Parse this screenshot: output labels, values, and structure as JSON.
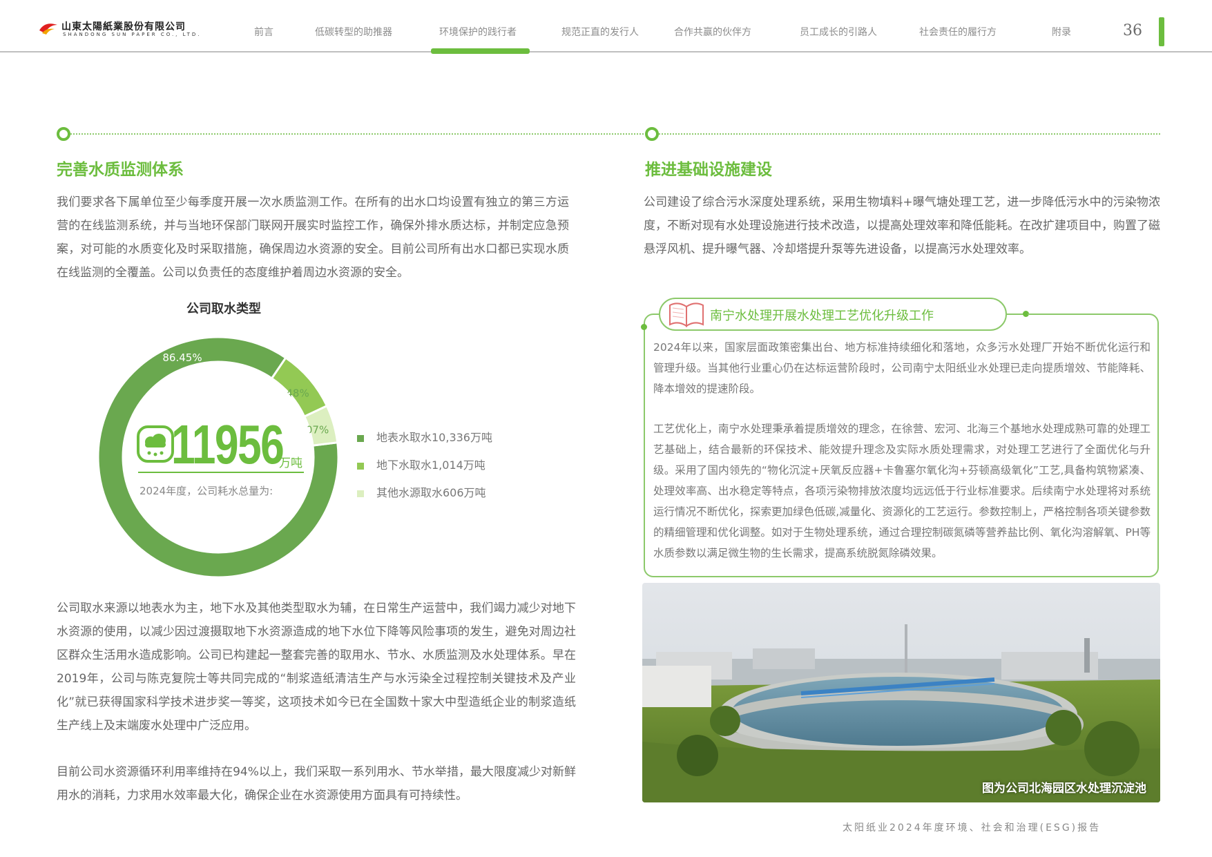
{
  "header": {
    "company_cn": "山東太陽紙業股份有限公司",
    "company_en": "SHANDONG SUN PAPER CO., LTD.",
    "nav": [
      "前言",
      "低碳转型的助推器",
      "环境保护的践行者",
      "规范正直的发行人",
      "合作共赢的伙伴方",
      "员工成长的引路人",
      "社会责任的履行方",
      "附录"
    ],
    "active_nav": "环境保护的践行者",
    "page_number": "36"
  },
  "left": {
    "title": "完善水质监测体系",
    "para1": "我们要求各下属单位至少每季度开展一次水质监测工作。在所有的出水口均设置有独立的第三方运营的在线监测系统，并与当地环保部门联网开展实时监控工作，确保外排水质达标，并制定应急预案，对可能的水质变化及时采取措施，确保周边水资源的安全。目前公司所有出水口都已实现水质在线监测的全覆盖。公司以负责任的态度维护着周边水资源的安全。",
    "para2": "公司取水来源以地表水为主，地下水及其他类型取水为辅，在日常生产运营中，我们竭力减少对地下水资源的使用，以减少因过渡摄取地下水资源造成的地下水位下降等风险事项的发生，避免对周边社区群众生活用水造成影响。公司已构建起一整套完善的取用水、节水、水质监测及水处理体系。早在2019年，公司与陈克复院士等共同完成的“制浆造纸清洁生产与水污染全过程控制关键技术及产业化”就已获得国家科学技术进步奖一等奖，这项技术如今已在全国数十家大中型造纸企业的制浆造纸生产线上及末端废水处理中广泛应用。",
    "para3": "目前公司水资源循环利用率维持在94%以上，我们采取一系列用水、节水举措，最大限度减少对新鲜用水的消耗，力求用水效率最大化，确保企业在水资源使用方面具有可持续性。"
  },
  "chart_data": {
    "type": "pie",
    "title": "公司取水类型",
    "total_value": "11956",
    "total_unit": "万吨",
    "total_caption": "2024年度，公司耗水总量为:",
    "categories": [
      "地表水取水10,336万吨",
      "地下水取水1,014万吨",
      "其他水源取水606万吨"
    ],
    "values": [
      86.45,
      8.48,
      5.07
    ],
    "value_labels": [
      "86.45%",
      "8.48%",
      "5.07%"
    ],
    "colors": [
      "#6aa84f",
      "#93c954",
      "#dcefc0"
    ],
    "label_colors": [
      "#ffffff",
      "#6aa84f",
      "#6aa84f"
    ],
    "legend_placement": "right"
  },
  "right": {
    "title": "推进基础设施建设",
    "para1": "公司建设了综合污水深度处理系统，采用生物填料+曝气塘处理工艺，进一步降低污水中的污染物浓度，不断对现有水处理设施进行技术改造，以提高处理效率和降低能耗。在改扩建项目中，购置了磁悬浮风机、提升曝气器、冷却塔提升泵等先进设备，以提高污水处理效率。",
    "case_title": "南宁水处理开展水处理工艺优化升级工作",
    "case_p1": "2024年以来，国家层面政策密集出台、地方标准持续细化和落地，众多污水处理厂开始不断优化运行和管理升级。当其他行业重心仍在达标运营阶段时，公司南宁太阳纸业水处理已走向提质增效、节能降耗、降本增效的提速阶段。",
    "case_p2": "工艺优化上，南宁水处理秉承着提质增效的理念，在徐营、宏河、北海三个基地水处理成熟可靠的处理工艺基础上，结合最新的环保技术、能效提升理念及实际水质处理需求，对处理工艺进行了全面优化与升级。采用了国内领先的“物化沉淀+厌氧反应器+卡鲁塞尔氧化沟+芬顿高级氧化”工艺,具备构筑物紧凑、处理效率高、出水稳定等特点，各项污染物排放浓度均远远低于行业标准要求。后续南宁水处理将对系统运行情况不断优化，探索更加绿色低碳,减量化、资源化的工艺运行。参数控制上，严格控制各项关键参数的精细管理和优化调整。如对于生物处理系统，通过合理控制碳氮磷等营养盐比例、氧化沟溶解氧、PH等水质参数以满足微生物的生长需求，提高系统脱氮除磷效果。",
    "photo_caption": "图为公司北海园区水处理沉淀池"
  },
  "footer": "太阳纸业2024年度环境、社会和治理(ESG)报告",
  "colors": {
    "accent": "#6cbd3e"
  }
}
